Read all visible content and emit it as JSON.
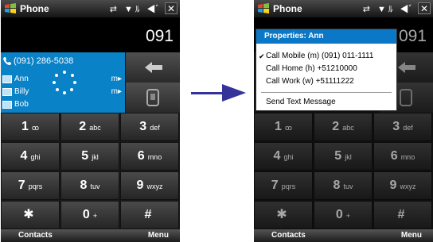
{
  "left_screen": {
    "title": "Phone",
    "status_icons": "⇄ ▼ﾙ ◀ﾞ",
    "close_label": "✕",
    "dialed_number": "091",
    "matched_number": "(091) 286-5038",
    "contacts": [
      {
        "name": "Ann",
        "tag": "m▸"
      },
      {
        "name": "Billy",
        "tag": "m▸"
      },
      {
        "name": "Bob",
        "tag": ""
      }
    ],
    "keys": [
      {
        "num": "1",
        "letters": "ꝏ"
      },
      {
        "num": "2",
        "letters": "abc"
      },
      {
        "num": "3",
        "letters": "def"
      },
      {
        "num": "4",
        "letters": "ghi"
      },
      {
        "num": "5",
        "letters": "jkl"
      },
      {
        "num": "6",
        "letters": "mno"
      },
      {
        "num": "7",
        "letters": "pqrs"
      },
      {
        "num": "8",
        "letters": "tuv"
      },
      {
        "num": "9",
        "letters": "wxyz"
      },
      {
        "num": "✱",
        "letters": ""
      },
      {
        "num": "0",
        "letters": "+"
      },
      {
        "num": "#",
        "letters": ""
      }
    ],
    "softkey_left": "Contacts",
    "softkey_right": "Menu"
  },
  "right_screen": {
    "title": "Phone",
    "status_icons": "⇄ ▼ﾙ ◀ﾞ",
    "close_label": "✕",
    "dialed_number": "091",
    "popup_title": "Properties: Ann",
    "menu_items": [
      {
        "label": "Call Mobile (m) (091) 011-1111",
        "checked": true
      },
      {
        "label": "Call Home (h) +51210000",
        "checked": false
      },
      {
        "label": "Call Work (w) +51111222",
        "checked": false
      },
      {
        "label": "Send Text Message",
        "checked": false
      }
    ],
    "check_mark": "✔",
    "keys": [
      {
        "num": "1",
        "letters": "ꝏ"
      },
      {
        "num": "2",
        "letters": "abc"
      },
      {
        "num": "3",
        "letters": "def"
      },
      {
        "num": "4",
        "letters": "ghi"
      },
      {
        "num": "5",
        "letters": "jkl"
      },
      {
        "num": "6",
        "letters": "mno"
      },
      {
        "num": "7",
        "letters": "pqrs"
      },
      {
        "num": "8",
        "letters": "tuv"
      },
      {
        "num": "9",
        "letters": "wxyz"
      },
      {
        "num": "✱",
        "letters": ""
      },
      {
        "num": "0",
        "letters": "+"
      },
      {
        "num": "#",
        "letters": ""
      }
    ],
    "softkey_left": "Contacts",
    "softkey_right": "Menu"
  },
  "colors": {
    "highlight_blue": "#0a82c8",
    "arrow": "#333399",
    "popup_header": "#0b78c7"
  },
  "icons": {
    "start": "windows-flag-icon",
    "backspace": "backspace-arrow-icon",
    "talk": "phone-handset-icon",
    "transition": "right-arrow-icon"
  }
}
